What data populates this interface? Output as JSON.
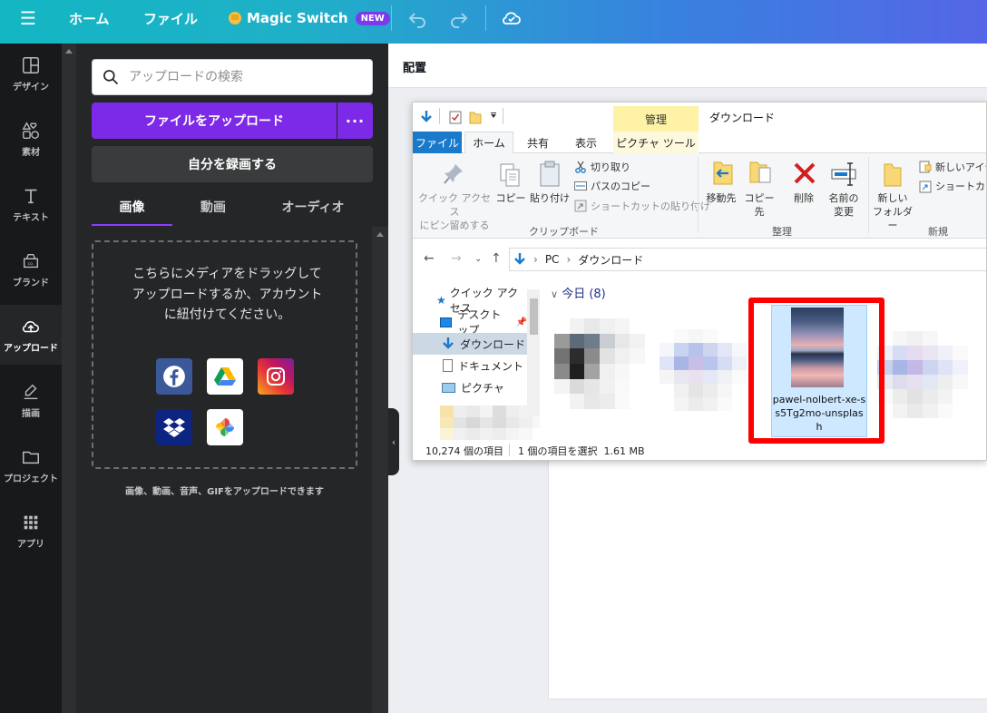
{
  "topbar": {
    "home": "ホーム",
    "file": "ファイル",
    "magic_switch": "Magic Switch",
    "new_badge": "NEW"
  },
  "rail": {
    "items": [
      {
        "label": "デザイン",
        "icon": "layout-icon"
      },
      {
        "label": "素材",
        "icon": "shapes-icon"
      },
      {
        "label": "テキスト",
        "icon": "text-icon"
      },
      {
        "label": "ブランド",
        "icon": "brand-icon"
      },
      {
        "label": "アップロード",
        "icon": "cloud-upload-icon"
      },
      {
        "label": "描画",
        "icon": "draw-icon"
      },
      {
        "label": "プロジェクト",
        "icon": "folder-icon"
      },
      {
        "label": "アプリ",
        "icon": "apps-grid-icon"
      }
    ],
    "active": "アップロード"
  },
  "panel": {
    "search_placeholder": "アップロードの検索",
    "upload_button": "ファイルをアップロード",
    "record_button": "自分を録画する",
    "tabs": [
      "画像",
      "動画",
      "オーディオ"
    ],
    "active_tab": "画像",
    "dropzone_text": "こちらにメディアをドラッグしてアップロードするか、アカウントに紐付けてください。",
    "services": [
      "facebook-icon",
      "google-drive-icon",
      "instagram-icon",
      "dropbox-icon",
      "google-photos-icon"
    ],
    "caption": "画像、動画、音声、GIFをアップロードできます"
  },
  "canvas": {
    "toolbar_label": "配置"
  },
  "explorer": {
    "window_title": "ダウンロード",
    "manage_tab": "管理",
    "tabs": [
      "ファイル",
      "ホーム",
      "共有",
      "表示",
      "ピクチャ ツール"
    ],
    "active_tab": "ホーム",
    "ribbon": {
      "pin_label": "クイック アクセス\nにピン留めする",
      "copy": "コピー",
      "paste": "貼り付け",
      "cut": "切り取り",
      "copy_path": "パスのコピー",
      "paste_shortcut": "ショートカットの貼り付け",
      "clipboard_group": "クリップボード",
      "move_to": "移動先",
      "copy_to": "コピー先",
      "delete": "削除",
      "rename": "名前の\n変更",
      "organize_group": "整理",
      "new_folder": "新しい\nフォルダー",
      "new_item": "新しいアイテ",
      "shortcut": "ショートカット",
      "new_group": "新規"
    },
    "breadcrumb": [
      "PC",
      "ダウンロード"
    ],
    "nav": [
      "クイック アクセス",
      "デスクトップ",
      "ダウンロード",
      "ドキュメント",
      "ピクチャ"
    ],
    "selected_nav": "ダウンロード",
    "group_header": "今日 (8)",
    "selected_file": "pawel-nolbert-xe-ss5Tg2mo-unsplash",
    "status_items": "10,274 個の項目",
    "status_selected": "1 個の項目を選択  1.61 MB"
  },
  "colors": {
    "upload_purple": "#7d2ae8",
    "highlight_red": "#ff0000",
    "explorer_file_tab": "#1979ca"
  }
}
